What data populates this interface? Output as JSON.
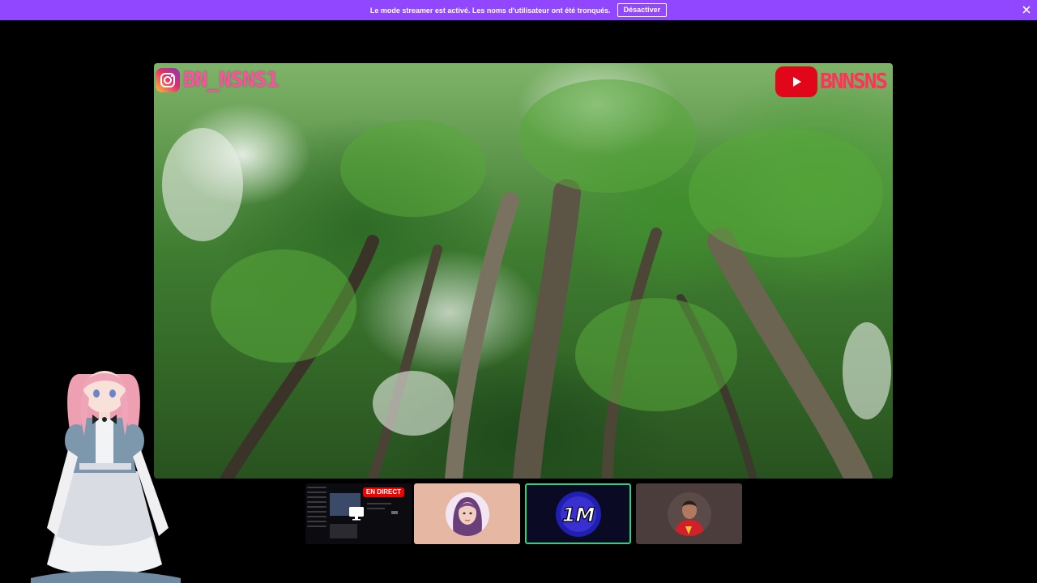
{
  "banner": {
    "message": "Le mode streamer est activé. Les noms d'utilisateur ont été tronqués.",
    "button_label": "Désactiver",
    "color": "#9146ff"
  },
  "video": {
    "overlay_instagram_handle": "BN_NSNS1",
    "overlay_youtube_handle": "BNNSNS",
    "icons": [
      "instagram-icon",
      "youtube-icon"
    ]
  },
  "thumbnails": {
    "live_badge": "EN DIRECT",
    "tile3_text": "1M",
    "active_border_color": "#2bd47b"
  }
}
